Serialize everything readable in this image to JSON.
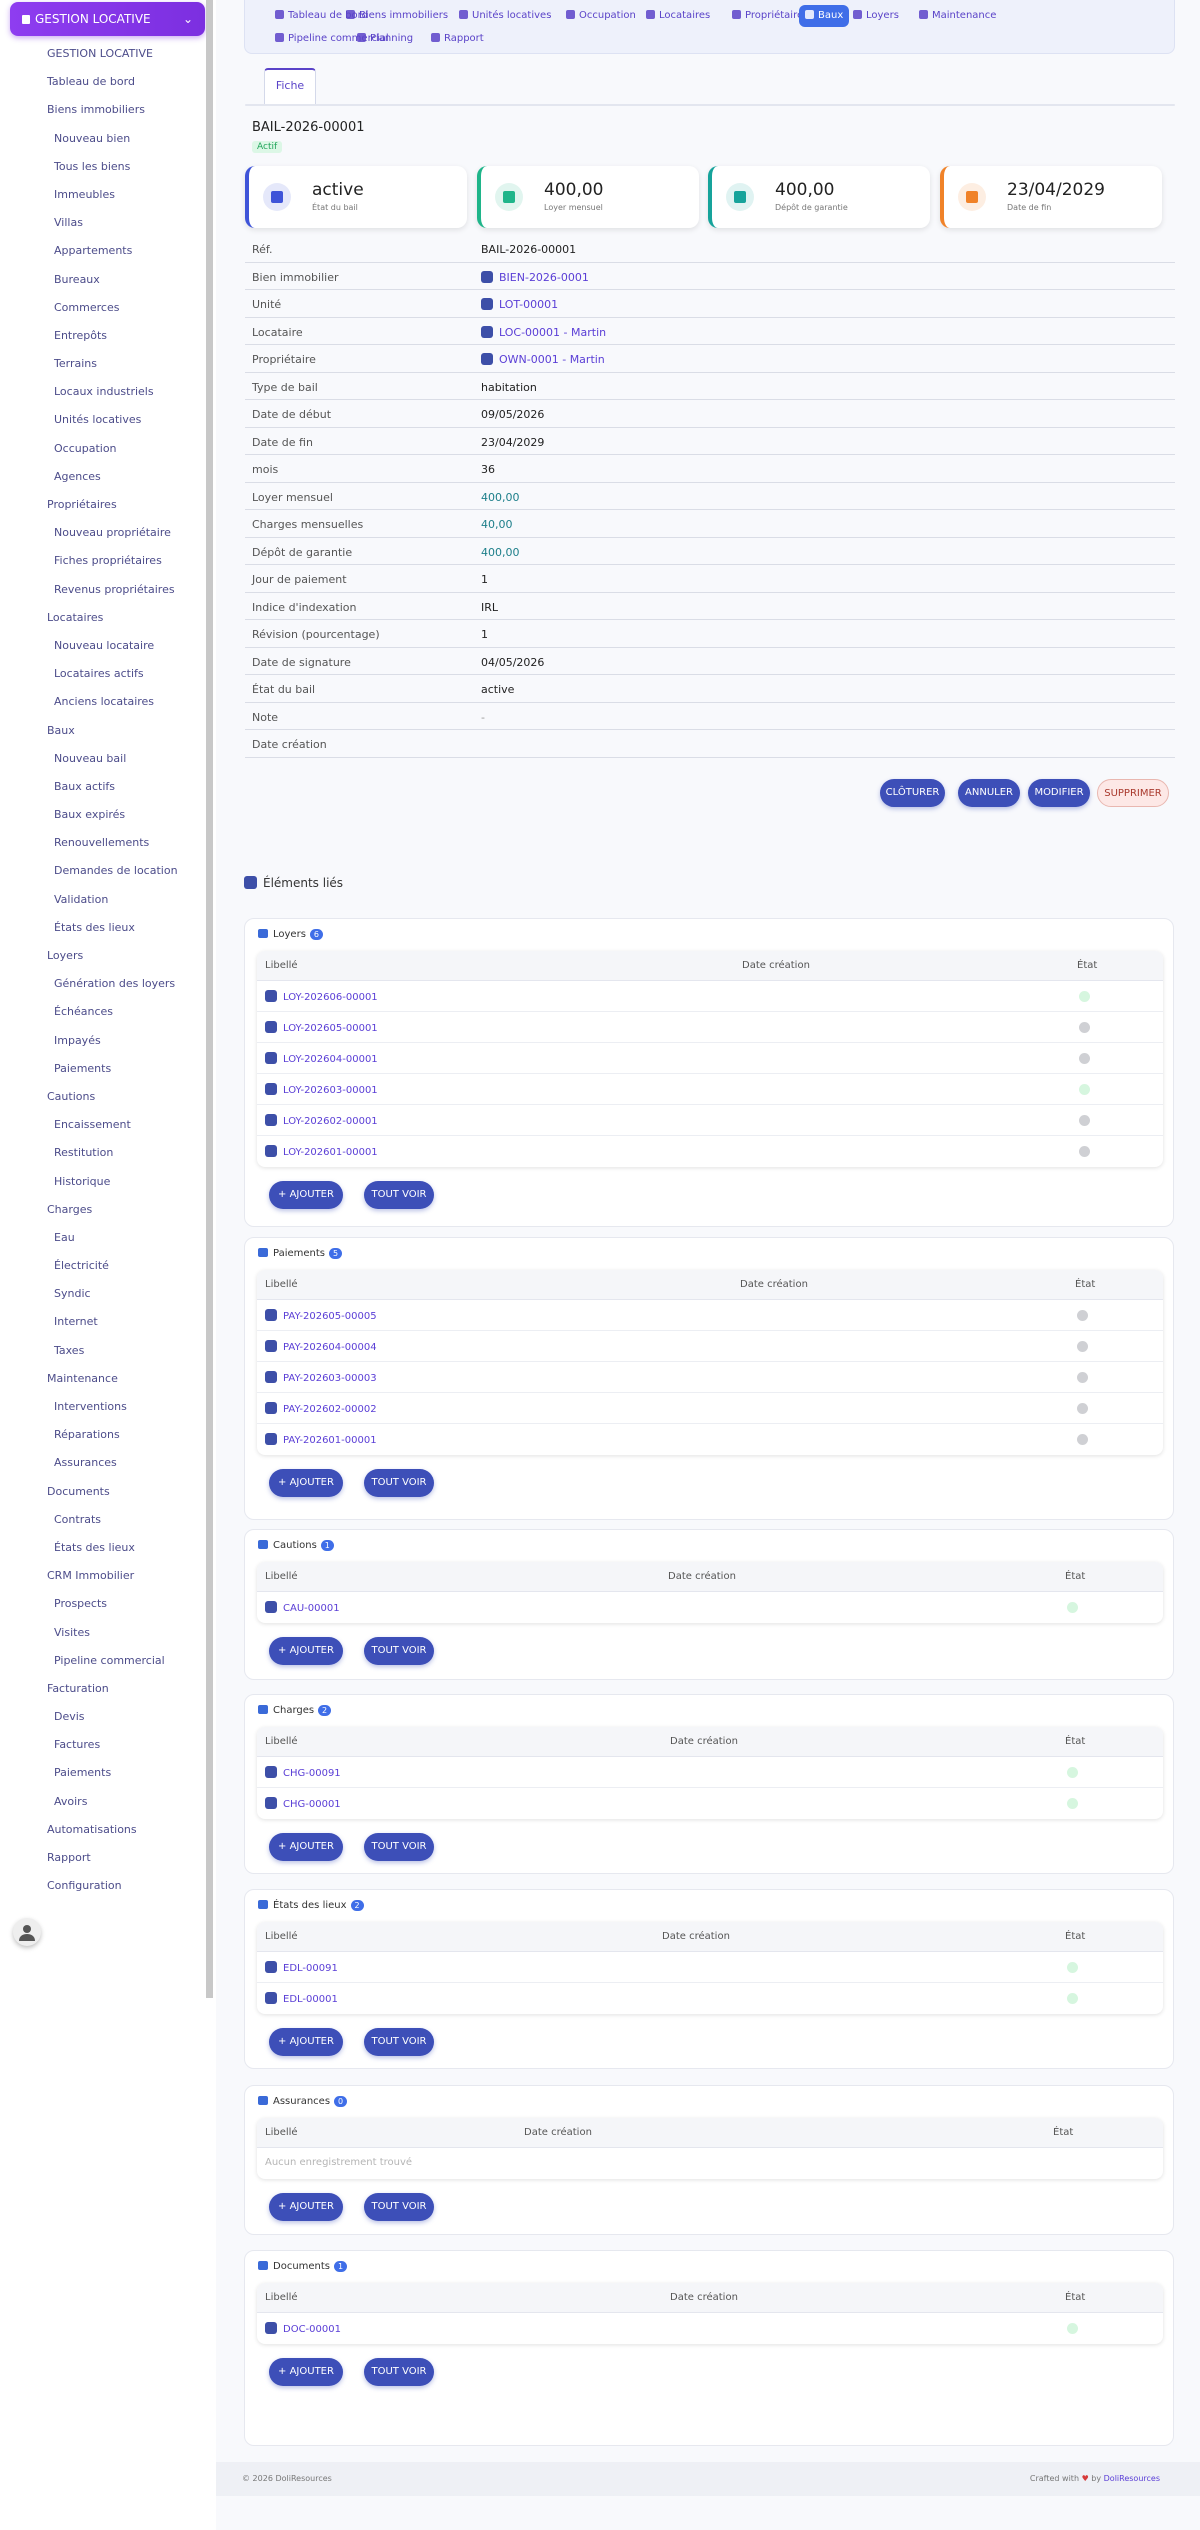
{
  "sidebar": {
    "brand": "GESTION LOCATIVE",
    "items": [
      {
        "label": "GESTION LOCATIVE",
        "lvl": 1
      },
      {
        "label": "Tableau de bord",
        "lvl": 1
      },
      {
        "label": "Biens immobiliers",
        "lvl": 1
      },
      {
        "label": "Nouveau bien",
        "lvl": 2
      },
      {
        "label": "Tous les biens",
        "lvl": 2
      },
      {
        "label": "Immeubles",
        "lvl": 2
      },
      {
        "label": "Villas",
        "lvl": 2
      },
      {
        "label": "Appartements",
        "lvl": 2
      },
      {
        "label": "Bureaux",
        "lvl": 2
      },
      {
        "label": "Commerces",
        "lvl": 2
      },
      {
        "label": "Entrepôts",
        "lvl": 2
      },
      {
        "label": "Terrains",
        "lvl": 2
      },
      {
        "label": "Locaux industriels",
        "lvl": 2
      },
      {
        "label": "Unités locatives",
        "lvl": 2
      },
      {
        "label": "Occupation",
        "lvl": 2
      },
      {
        "label": "Agences",
        "lvl": 2
      },
      {
        "label": "Propriétaires",
        "lvl": 1
      },
      {
        "label": "Nouveau propriétaire",
        "lvl": 2
      },
      {
        "label": "Fiches propriétaires",
        "lvl": 2
      },
      {
        "label": "Revenus propriétaires",
        "lvl": 2
      },
      {
        "label": "Locataires",
        "lvl": 1
      },
      {
        "label": "Nouveau locataire",
        "lvl": 2
      },
      {
        "label": "Locataires actifs",
        "lvl": 2
      },
      {
        "label": "Anciens locataires",
        "lvl": 2
      },
      {
        "label": "Baux",
        "lvl": 1
      },
      {
        "label": "Nouveau bail",
        "lvl": 2
      },
      {
        "label": "Baux actifs",
        "lvl": 2
      },
      {
        "label": "Baux expirés",
        "lvl": 2
      },
      {
        "label": "Renouvellements",
        "lvl": 2
      },
      {
        "label": "Demandes de location",
        "lvl": 2
      },
      {
        "label": "Validation",
        "lvl": 2
      },
      {
        "label": "États des lieux",
        "lvl": 2
      },
      {
        "label": "Loyers",
        "lvl": 1
      },
      {
        "label": "Génération des loyers",
        "lvl": 2
      },
      {
        "label": "Échéances",
        "lvl": 2
      },
      {
        "label": "Impayés",
        "lvl": 2
      },
      {
        "label": "Paiements",
        "lvl": 2
      },
      {
        "label": "Cautions",
        "lvl": 1
      },
      {
        "label": "Encaissement",
        "lvl": 2
      },
      {
        "label": "Restitution",
        "lvl": 2
      },
      {
        "label": "Historique",
        "lvl": 2
      },
      {
        "label": "Charges",
        "lvl": 1
      },
      {
        "label": "Eau",
        "lvl": 2
      },
      {
        "label": "Électricité",
        "lvl": 2
      },
      {
        "label": "Syndic",
        "lvl": 2
      },
      {
        "label": "Internet",
        "lvl": 2
      },
      {
        "label": "Taxes",
        "lvl": 2
      },
      {
        "label": "Maintenance",
        "lvl": 1
      },
      {
        "label": "Interventions",
        "lvl": 2
      },
      {
        "label": "Réparations",
        "lvl": 2
      },
      {
        "label": "Assurances",
        "lvl": 2
      },
      {
        "label": "Documents",
        "lvl": 1
      },
      {
        "label": "Contrats",
        "lvl": 2
      },
      {
        "label": "États des lieux",
        "lvl": 2
      },
      {
        "label": "CRM Immobilier",
        "lvl": 1
      },
      {
        "label": "Prospects",
        "lvl": 2
      },
      {
        "label": "Visites",
        "lvl": 2
      },
      {
        "label": "Pipeline commercial",
        "lvl": 2
      },
      {
        "label": "Facturation",
        "lvl": 1
      },
      {
        "label": "Devis",
        "lvl": 2
      },
      {
        "label": "Factures",
        "lvl": 2
      },
      {
        "label": "Paiements",
        "lvl": 2
      },
      {
        "label": "Avoirs",
        "lvl": 2
      },
      {
        "label": "Automatisations",
        "lvl": 1
      },
      {
        "label": "Rapport",
        "lvl": 1
      },
      {
        "label": "Configuration",
        "lvl": 1
      }
    ]
  },
  "topnav": {
    "items": [
      "Tableau de bord",
      "Biens immobiliers",
      "Unités locatives",
      "Occupation",
      "Locataires",
      "Propriétaires",
      "Baux",
      "Loyers",
      "Maintenance",
      "Pipeline commercial",
      "Planning",
      "Rapport"
    ],
    "active": "Baux"
  },
  "tab": "Fiche",
  "lease": {
    "title": "BAIL-2026-00001",
    "badge": "Actif",
    "kpis": [
      {
        "value": "active",
        "label": "État du bail",
        "color": "#3f54d8",
        "icon": "contract-icon"
      },
      {
        "value": "400,00",
        "label": "Loyer mensuel",
        "color": "#1fb58a",
        "icon": "money-stack-icon"
      },
      {
        "value": "400,00",
        "label": "Dépôt de garantie",
        "color": "#16a39b",
        "icon": "cash-icon"
      },
      {
        "value": "23/04/2029",
        "label": "Date de fin",
        "color": "#f08228",
        "icon": "calendar-icon"
      }
    ],
    "fields": [
      {
        "label": "Réf.",
        "value": "BAIL-2026-00001",
        "kind": "text"
      },
      {
        "label": "Bien immobilier",
        "value": "BIEN-2026-0001",
        "kind": "link"
      },
      {
        "label": "Unité",
        "value": "LOT-00001",
        "kind": "link"
      },
      {
        "label": "Locataire",
        "value": "LOC-00001 - Martin",
        "kind": "link"
      },
      {
        "label": "Propriétaire",
        "value": "OWN-0001 - Martin",
        "kind": "link"
      },
      {
        "label": "Type de bail",
        "value": "habitation",
        "kind": "text"
      },
      {
        "label": "Date de début",
        "value": "09/05/2026",
        "kind": "text"
      },
      {
        "label": "Date de fin",
        "value": "23/04/2029",
        "kind": "text"
      },
      {
        "label": "mois",
        "value": "36",
        "kind": "text"
      },
      {
        "label": "Loyer mensuel",
        "value": "400,00",
        "kind": "money"
      },
      {
        "label": "Charges mensuelles",
        "value": "40,00",
        "kind": "money"
      },
      {
        "label": "Dépôt de garantie",
        "value": "400,00",
        "kind": "money"
      },
      {
        "label": "Jour de paiement",
        "value": "1",
        "kind": "text"
      },
      {
        "label": "Indice d'indexation",
        "value": "IRL",
        "kind": "text"
      },
      {
        "label": "Révision (pourcentage)",
        "value": "1",
        "kind": "text"
      },
      {
        "label": "Date de signature",
        "value": "04/05/2026",
        "kind": "text"
      },
      {
        "label": "État du bail",
        "value": "active",
        "kind": "text"
      },
      {
        "label": "Note",
        "value": "-",
        "kind": "muted"
      },
      {
        "label": "Date création",
        "value": "",
        "kind": "text"
      }
    ],
    "actions": [
      "CLÔTURER",
      "ANNULER",
      "MODIFIER",
      "SUPPRIMER"
    ]
  },
  "linked": {
    "title": "Éléments liés",
    "col_label": "Libellé",
    "col_date": "Date création",
    "col_state": "État",
    "add_label": "+ AJOUTER",
    "all_label": "TOUT VOIR",
    "sections": [
      {
        "name": "Loyers",
        "count": "6",
        "rows": [
          {
            "ref": "LOY-202606-00001",
            "state": "green"
          },
          {
            "ref": "LOY-202605-00001",
            "state": "gray"
          },
          {
            "ref": "LOY-202604-00001",
            "state": "gray"
          },
          {
            "ref": "LOY-202603-00001",
            "state": "green"
          },
          {
            "ref": "LOY-202602-00001",
            "state": "gray"
          },
          {
            "ref": "LOY-202601-00001",
            "state": "gray"
          }
        ]
      },
      {
        "name": "Paiements",
        "count": "5",
        "rows": [
          {
            "ref": "PAY-202605-00005",
            "state": "gray"
          },
          {
            "ref": "PAY-202604-00004",
            "state": "gray"
          },
          {
            "ref": "PAY-202603-00003",
            "state": "gray"
          },
          {
            "ref": "PAY-202602-00002",
            "state": "gray"
          },
          {
            "ref": "PAY-202601-00001",
            "state": "gray"
          }
        ]
      },
      {
        "name": "Cautions",
        "count": "1",
        "rows": [
          {
            "ref": "CAU-00001",
            "state": "green"
          }
        ]
      },
      {
        "name": "Charges",
        "count": "2",
        "rows": [
          {
            "ref": "CHG-00091",
            "state": "green"
          },
          {
            "ref": "CHG-00001",
            "state": "green"
          }
        ]
      },
      {
        "name": "États des lieux",
        "count": "2",
        "rows": [
          {
            "ref": "EDL-00091",
            "state": "green"
          },
          {
            "ref": "EDL-00001",
            "state": "green"
          }
        ]
      },
      {
        "name": "Assurances",
        "count": "0",
        "rows": [],
        "empty": "Aucun enregistrement trouvé"
      },
      {
        "name": "Documents",
        "count": "1",
        "rows": [
          {
            "ref": "DOC-00001",
            "state": "green"
          }
        ]
      }
    ]
  },
  "footer": {
    "left": "© 2026 DoliResources",
    "right_prefix": "Crafted with",
    "heart": "♥",
    "right_by": "by",
    "right_brand": "DoliResources"
  }
}
